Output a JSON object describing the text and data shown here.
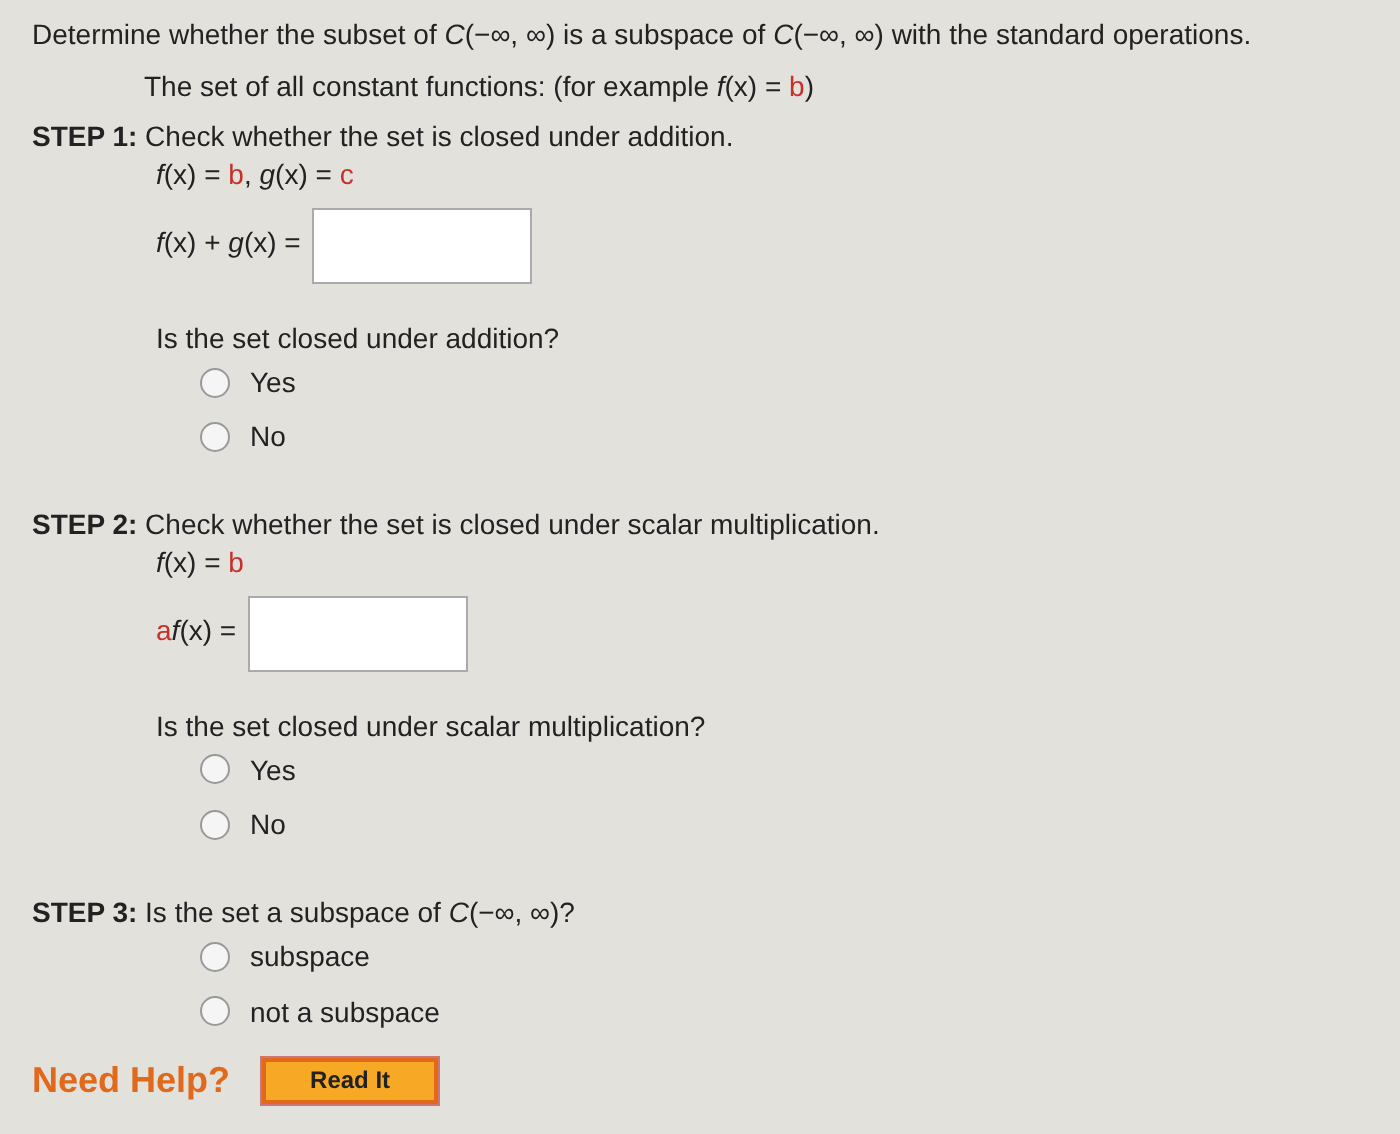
{
  "question": "Determine whether the subset of *C*(−∞, ∞) is a subspace of *C*(−∞, ∞) with the standard operations.",
  "description": [
    {
      "text": "The set of all constant functions: (for example *f*(x) = ",
      "red": false
    },
    {
      "text": "b",
      "red": true
    },
    {
      "text": ")",
      "red": false
    }
  ],
  "steps": [
    {
      "label": "STEP 1:",
      "text": "Check whether the set is closed under addition.",
      "formula": [
        {
          "text": "*f*(x) = ",
          "red": false
        },
        {
          "text": "b",
          "red": true
        },
        {
          "text": ", *g*(x) = ",
          "red": false
        },
        {
          "text": "c",
          "red": true
        }
      ],
      "answer_label": [
        {
          "text": "*f*(x) + *g*(x) =",
          "red": false
        }
      ],
      "prompt": "Is the set closed under addition?",
      "options": [
        {
          "label": "Yes",
          "selected": false
        },
        {
          "label": "No",
          "selected": false
        }
      ]
    },
    {
      "label": "STEP 2:",
      "text": "Check whether the set is closed under scalar multiplication.",
      "formula": [
        {
          "text": "*f*(x) = ",
          "red": false
        },
        {
          "text": "b",
          "red": true
        }
      ],
      "answer_label": [
        {
          "text": "a",
          "red": true
        },
        {
          "text": "*f*(x) =",
          "red": false
        }
      ],
      "prompt": "Is the set closed under scalar multiplication?",
      "options": [
        {
          "label": "Yes",
          "selected": false
        },
        {
          "label": "No",
          "selected": false
        }
      ]
    },
    {
      "label": "STEP 3:",
      "text": "Is the set a subspace of *C*(−∞, ∞)?",
      "options": [
        {
          "label": "subspace",
          "selected": false
        },
        {
          "label": "not a subspace",
          "selected": false
        }
      ]
    }
  ],
  "help": {
    "label": "Need Help?",
    "button": "Read It"
  }
}
